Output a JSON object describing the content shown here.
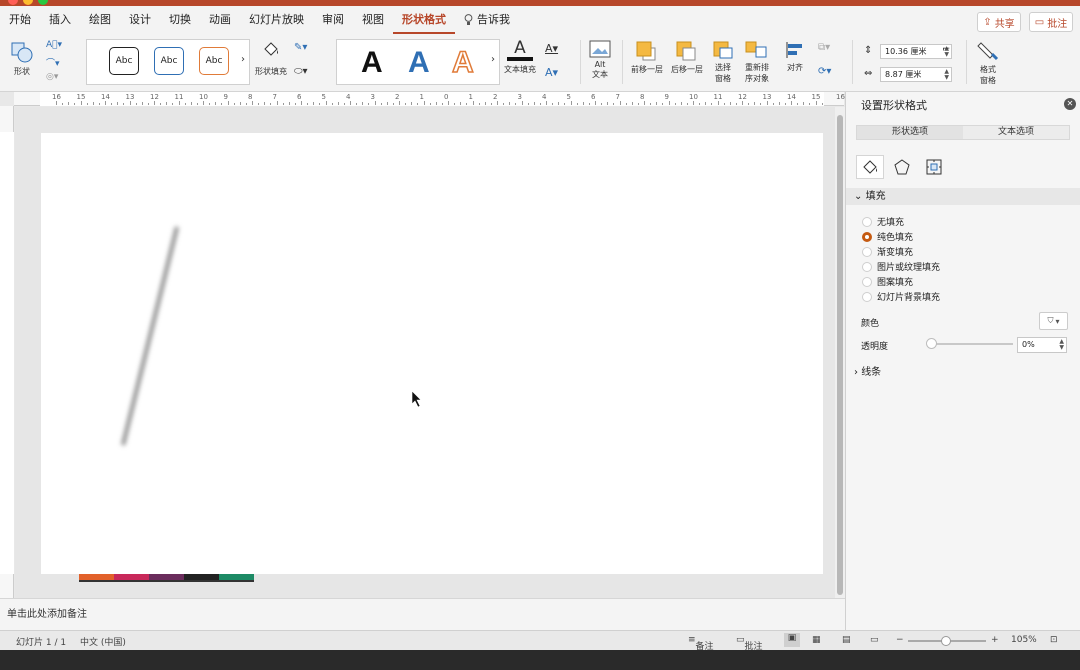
{
  "colors": {
    "accent": "#b7472a",
    "radio_on": "#c55a11"
  },
  "tabs": [
    "开始",
    "插入",
    "绘图",
    "设计",
    "切换",
    "动画",
    "幻灯片放映",
    "审阅",
    "视图",
    "形状格式"
  ],
  "tell_me": "告诉我",
  "header_buttons": {
    "share": "共享",
    "comment": "批注"
  },
  "ribbon": {
    "shape_label": "形状",
    "style_preview": "Abc",
    "shape_fill_label": "形状填充",
    "wordart_letter": "A",
    "text_fill_label": "文本填充",
    "alt_text_label_1": "Alt",
    "alt_text_label_2": "文本",
    "bring_forward": "前移一层",
    "send_backward": "后移一层",
    "selection_pane_1": "选择",
    "selection_pane_2": "窗格",
    "reorder_1": "重新排",
    "reorder_2": "序对象",
    "align": "对齐",
    "height": "10.36 厘米",
    "width": "8.87 厘米",
    "format_pane_1": "格式",
    "format_pane_2": "窗格"
  },
  "ruler_labels": [
    "16",
    "15",
    "14",
    "13",
    "12",
    "11",
    "10",
    "9",
    "8",
    "7",
    "6",
    "5",
    "4",
    "3",
    "2",
    "1",
    "0",
    "1",
    "2",
    "3",
    "4",
    "5",
    "6",
    "7",
    "8",
    "9",
    "10",
    "11",
    "12",
    "13",
    "14",
    "15",
    "16"
  ],
  "notes_placeholder": "单击此处添加备注",
  "status": {
    "slide": "幻灯片 1 / 1",
    "language": "中文 (中国)",
    "notes": "备注",
    "comments": "批注",
    "zoom": "105%"
  },
  "pane": {
    "title": "设置形状格式",
    "tab_shape": "形状选项",
    "tab_text": "文本选项",
    "fill_section": "填充",
    "fill_options": [
      "无填充",
      "纯色填充",
      "渐变填充",
      "图片或纹理填充",
      "图案填充",
      "幻灯片背景填充"
    ],
    "selected_fill": 1,
    "color_label": "颜色",
    "transparency_label": "透明度",
    "transparency_value": "0%",
    "line_section": "线条"
  }
}
